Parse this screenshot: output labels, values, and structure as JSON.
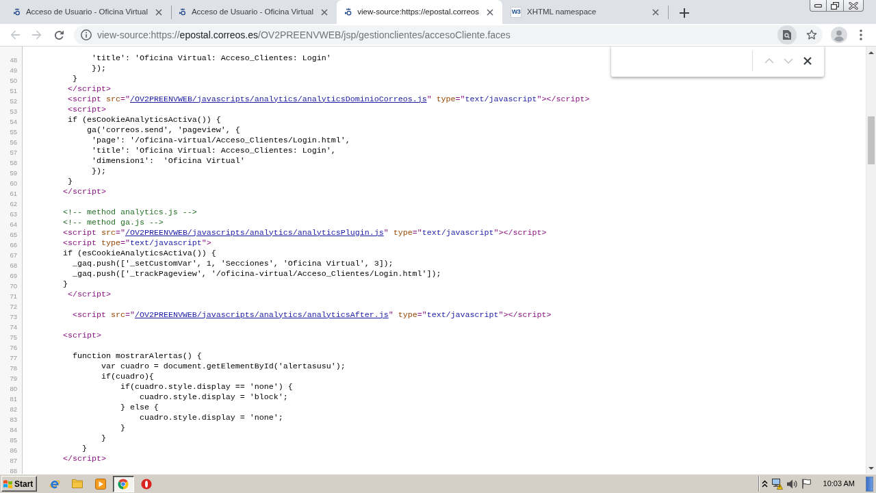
{
  "tabs": [
    {
      "title": "Acceso de Usuario - Oficina Virtual",
      "selected": false,
      "icon": {
        "kind": "postal"
      }
    },
    {
      "title": "Acceso de Usuario - Oficina Virtual",
      "selected": false,
      "icon": {
        "kind": "postal"
      }
    },
    {
      "title": "view-source:https://epostal.correos",
      "selected": true,
      "icon": {
        "kind": "postal"
      }
    },
    {
      "title": "XHTML namespace",
      "selected": false,
      "icon": {
        "kind": "logo",
        "text": "W3"
      }
    }
  ],
  "toolbar": {
    "back": {
      "disabled": true
    },
    "forward": {
      "disabled": true
    },
    "url": {
      "scheme": "view-source:https://",
      "host": "epostal.correos.es",
      "path": "/OV2PREENVWEB/jsp/gestionclientes/accesoCliente.faces"
    },
    "find_in_page": {
      "active": true
    },
    "bookmark": {
      "active": false
    }
  },
  "find_bar": {
    "previous": {
      "disabled": true
    },
    "next": {
      "disabled": true
    }
  },
  "source": {
    "lines": [
      {
        "number": "48",
        "tokens": [
          {
            "kind": "text",
            "text": "              'title': 'Oficina Virtual: Acceso_Clientes: Login'"
          }
        ]
      },
      {
        "number": "49",
        "tokens": [
          {
            "kind": "text",
            "text": "              });"
          }
        ]
      },
      {
        "number": "50",
        "tokens": [
          {
            "kind": "text",
            "text": "          }"
          }
        ]
      },
      {
        "number": "51",
        "tokens": [
          {
            "kind": "tag",
            "text": "         </script>"
          }
        ]
      },
      {
        "number": "52",
        "tokens": [
          {
            "kind": "tag",
            "text": "         <script "
          },
          {
            "kind": "attr",
            "text": "src"
          },
          {
            "kind": "tag",
            "text": "=\""
          },
          {
            "kind": "link",
            "text": "/OV2PREENVWEB/javascripts/analytics/analyticsDominioCorreos.js"
          },
          {
            "kind": "tag",
            "text": "\" "
          },
          {
            "kind": "attr",
            "text": "type"
          },
          {
            "kind": "tag",
            "text": "=\""
          },
          {
            "kind": "value",
            "text": "text/javascript"
          },
          {
            "kind": "tag",
            "text": "\"></script>"
          }
        ]
      },
      {
        "number": "53",
        "tokens": [
          {
            "kind": "tag",
            "text": "         <script>"
          }
        ]
      },
      {
        "number": "54",
        "tokens": [
          {
            "kind": "text",
            "text": "         if (esCookieAnalyticsActiva()) {"
          }
        ]
      },
      {
        "number": "55",
        "tokens": [
          {
            "kind": "text",
            "text": "             ga('correos.send', 'pageview', {"
          }
        ]
      },
      {
        "number": "56",
        "tokens": [
          {
            "kind": "text",
            "text": "              'page': '/oficina-virtual/Acceso_Clientes/Login.html',"
          }
        ]
      },
      {
        "number": "57",
        "tokens": [
          {
            "kind": "text",
            "text": "              'title': 'Oficina Virtual: Acceso_Clientes: Login',"
          }
        ]
      },
      {
        "number": "58",
        "tokens": [
          {
            "kind": "text",
            "text": "              'dimension1':  'Oficina Virtual'"
          }
        ]
      },
      {
        "number": "59",
        "tokens": [
          {
            "kind": "text",
            "text": "              });"
          }
        ]
      },
      {
        "number": "60",
        "tokens": [
          {
            "kind": "text",
            "text": "         }"
          }
        ]
      },
      {
        "number": "61",
        "tokens": [
          {
            "kind": "tag",
            "text": "        </script>"
          }
        ]
      },
      {
        "number": "62"
      },
      {
        "number": "63",
        "tokens": [
          {
            "kind": "comment",
            "text": "        <!-- method analytics.js -->"
          }
        ]
      },
      {
        "number": "64",
        "tokens": [
          {
            "kind": "comment",
            "text": "        <!-- method ga.js -->"
          }
        ]
      },
      {
        "number": "65",
        "tokens": [
          {
            "kind": "tag",
            "text": "        <script "
          },
          {
            "kind": "attr",
            "text": "src"
          },
          {
            "kind": "tag",
            "text": "=\""
          },
          {
            "kind": "link",
            "text": "/OV2PREENVWEB/javascripts/analytics/analyticsPlugin.js"
          },
          {
            "kind": "tag",
            "text": "\" "
          },
          {
            "kind": "attr",
            "text": "type"
          },
          {
            "kind": "tag",
            "text": "=\""
          },
          {
            "kind": "value",
            "text": "text/javascript"
          },
          {
            "kind": "tag",
            "text": "\"></script>"
          }
        ]
      },
      {
        "number": "66",
        "tokens": [
          {
            "kind": "tag",
            "text": "        <script "
          },
          {
            "kind": "attr",
            "text": "type"
          },
          {
            "kind": "tag",
            "text": "=\""
          },
          {
            "kind": "value",
            "text": "text/javascript"
          },
          {
            "kind": "tag",
            "text": "\">"
          }
        ]
      },
      {
        "number": "67",
        "tokens": [
          {
            "kind": "text",
            "text": "        if (esCookieAnalyticsActiva()) {"
          }
        ]
      },
      {
        "number": "68",
        "tokens": [
          {
            "kind": "text",
            "text": "          _gaq.push(['_setCustomVar', 1, 'Secciones', 'Oficina Virtual', 3]);"
          }
        ]
      },
      {
        "number": "69",
        "tokens": [
          {
            "kind": "text",
            "text": "          _gaq.push(['_trackPageview', '/oficina-virtual/Acceso_Clientes/Login.html']);"
          }
        ]
      },
      {
        "number": "70",
        "tokens": [
          {
            "kind": "text",
            "text": "        }"
          }
        ]
      },
      {
        "number": "71",
        "tokens": [
          {
            "kind": "tag",
            "text": "         </script>"
          }
        ]
      },
      {
        "number": "72"
      },
      {
        "number": "73",
        "tokens": [
          {
            "kind": "tag",
            "text": "          <script "
          },
          {
            "kind": "attr",
            "text": "src"
          },
          {
            "kind": "tag",
            "text": "=\""
          },
          {
            "kind": "link",
            "text": "/OV2PREENVWEB/javascripts/analytics/analyticsAfter.js"
          },
          {
            "kind": "tag",
            "text": "\" "
          },
          {
            "kind": "attr",
            "text": "type"
          },
          {
            "kind": "tag",
            "text": "=\""
          },
          {
            "kind": "value",
            "text": "text/javascript"
          },
          {
            "kind": "tag",
            "text": "\"></script>"
          }
        ]
      },
      {
        "number": "74"
      },
      {
        "number": "75",
        "tokens": [
          {
            "kind": "tag",
            "text": "        <script>"
          }
        ]
      },
      {
        "number": "76"
      },
      {
        "number": "77",
        "tokens": [
          {
            "kind": "text",
            "text": "          function mostrarAlertas() {"
          }
        ]
      },
      {
        "number": "78",
        "tokens": [
          {
            "kind": "text",
            "text": "                var cuadro = document.getElementById('alertasusu');"
          }
        ]
      },
      {
        "number": "79",
        "tokens": [
          {
            "kind": "text",
            "text": "                if(cuadro){"
          }
        ]
      },
      {
        "number": "80",
        "tokens": [
          {
            "kind": "text",
            "text": "                    if(cuadro.style.display == 'none') {"
          }
        ]
      },
      {
        "number": "81",
        "tokens": [
          {
            "kind": "text",
            "text": "                        cuadro.style.display = 'block';"
          }
        ]
      },
      {
        "number": "82",
        "tokens": [
          {
            "kind": "text",
            "text": "                    } else {"
          }
        ]
      },
      {
        "number": "83",
        "tokens": [
          {
            "kind": "text",
            "text": "                        cuadro.style.display = 'none';"
          }
        ]
      },
      {
        "number": "84",
        "tokens": [
          {
            "kind": "text",
            "text": "                    }"
          }
        ]
      },
      {
        "number": "85",
        "tokens": [
          {
            "kind": "text",
            "text": "                }"
          }
        ]
      },
      {
        "number": "86",
        "tokens": [
          {
            "kind": "text",
            "text": "            }"
          }
        ]
      },
      {
        "number": "87",
        "tokens": [
          {
            "kind": "tag",
            "text": "        </script>"
          }
        ]
      },
      {
        "number": "88"
      }
    ]
  },
  "taskbar": {
    "start": "Start",
    "items": [
      {
        "kind": "web",
        "selected": false
      },
      {
        "kind": "folder",
        "selected": false
      },
      {
        "kind": "player",
        "selected": false
      },
      {
        "kind": "browser",
        "selected": true
      },
      {
        "kind": "alert",
        "selected": false
      }
    ],
    "clock": "10:03 AM"
  }
}
